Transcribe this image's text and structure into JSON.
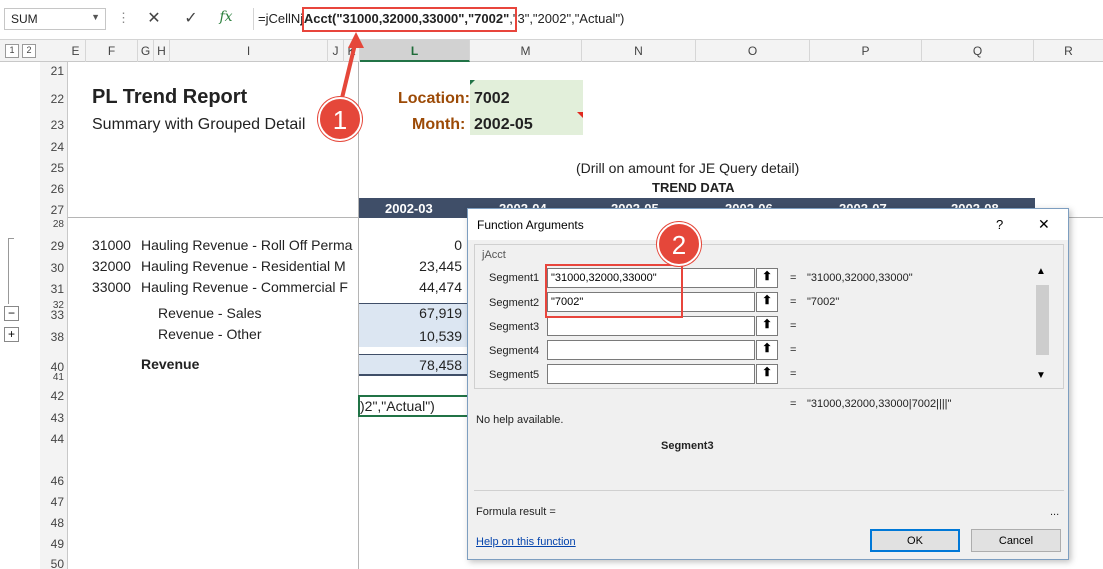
{
  "formula_bar": {
    "name_box": "SUM",
    "cancel_icon": "✕",
    "enter_icon": "✓",
    "fx_label": "fx",
    "formula_prefix": "=jCellN",
    "formula_highlight": "jAcct(\"31000,32000,33000\",\"7002\"",
    "formula_suffix": ",\"3\",\"2002\",\"Actual\")"
  },
  "outline_levels": [
    "1",
    "2"
  ],
  "columns": [
    "E",
    "F",
    "G",
    "H",
    "I",
    "J",
    "K",
    "L",
    "M",
    "N",
    "O",
    "P",
    "Q",
    "R"
  ],
  "rows": [
    "21",
    "22",
    "23",
    "24",
    "25",
    "26",
    "27",
    "28",
    "29",
    "30",
    "31",
    "32",
    "33",
    "38",
    "40",
    "41",
    "42",
    "43",
    "44",
    "46",
    "47",
    "48",
    "49",
    "50"
  ],
  "report": {
    "title": "PL Trend Report",
    "subtitle": "Summary with Grouped Detail",
    "location_label": "Location:",
    "location_value": "7002",
    "month_label": "Month:",
    "month_value": "2002-05",
    "drill_note": "(Drill on amount for JE Query detail)",
    "trend_header": "TREND DATA",
    "period_headers": [
      "2002-03",
      "2002-04",
      "2002-05",
      "2002-06",
      "2002-07",
      "2002-08"
    ]
  },
  "detail_rows": [
    {
      "acct": "31000",
      "desc": "Hauling Revenue - Roll Off Perma",
      "value": "0"
    },
    {
      "acct": "32000",
      "desc": "Hauling Revenue - Residential M",
      "value": "23,445"
    },
    {
      "acct": "33000",
      "desc": "Hauling Revenue - Commercial F",
      "value": "44,474"
    }
  ],
  "summary_rows": [
    {
      "label": "Revenue - Sales",
      "value": "67,919"
    },
    {
      "label": "Revenue - Other",
      "value": "10,539"
    }
  ],
  "total_row": {
    "label": "Revenue",
    "value": "78,458"
  },
  "edit_cell_text": ")2\",\"Actual\")",
  "dialog": {
    "title": "Function Arguments",
    "help_icon": "?",
    "close_icon": "✕",
    "function_name": "jAcct",
    "args": [
      {
        "label": "Segment1",
        "value": "\"31000,32000,33000\"",
        "result": "\"31000,32000,33000\""
      },
      {
        "label": "Segment2",
        "value": "\"7002\"",
        "result": "\"7002\""
      },
      {
        "label": "Segment3",
        "value": "",
        "result": ""
      },
      {
        "label": "Segment4",
        "value": "",
        "result": ""
      },
      {
        "label": "Segment5",
        "value": "",
        "result": ""
      }
    ],
    "combined_result": "\"31000,32000,33000|7002||||\"",
    "help_text": "No help available.",
    "current_arg": "Segment3",
    "formula_result_label": "Formula result =",
    "formula_result_value": "...",
    "help_link": "Help on this function",
    "ok_label": "OK",
    "cancel_label": "Cancel"
  },
  "annotations": {
    "badge1": "1",
    "badge2": "2"
  },
  "colors": {
    "accent_red": "#e5473a",
    "excel_green": "#217346",
    "header_navy": "#3f4e68",
    "location_orange": "#9c4a06",
    "input_green": "#e2efda",
    "summary_blue": "#dce6f2"
  }
}
